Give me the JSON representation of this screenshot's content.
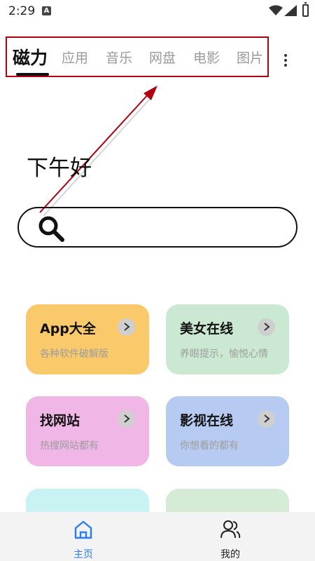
{
  "status_bar": {
    "time": "2:29",
    "notification_badge": "A"
  },
  "tabs": [
    {
      "label": "磁力",
      "active": true
    },
    {
      "label": "应用",
      "active": false
    },
    {
      "label": "音乐",
      "active": false
    },
    {
      "label": "网盘",
      "active": false
    },
    {
      "label": "电影",
      "active": false
    },
    {
      "label": "图片",
      "active": false
    }
  ],
  "greeting": "下午好",
  "search": {
    "placeholder": "",
    "icon": "search-icon"
  },
  "cards": [
    {
      "title": "App大全",
      "subtitle": "各种软件破解版",
      "color": "#f9c96a"
    },
    {
      "title": "美女在线",
      "subtitle": "养眼提示，愉悦心情",
      "color": "#cbe9d2"
    },
    {
      "title": "找网站",
      "subtitle": "热搜网站都有",
      "color": "#efb6e6"
    },
    {
      "title": "影视在线",
      "subtitle": "你想看的都有",
      "color": "#b7caf1"
    }
  ],
  "bottom_nav": [
    {
      "label": "主页",
      "icon": "home-icon",
      "active": true,
      "color": "#2a7cf6"
    },
    {
      "label": "我的",
      "icon": "profile-icon",
      "active": false,
      "color": "#222222"
    }
  ],
  "colors": {
    "highlight_box": "#b00010",
    "arrow": "#b00010"
  }
}
